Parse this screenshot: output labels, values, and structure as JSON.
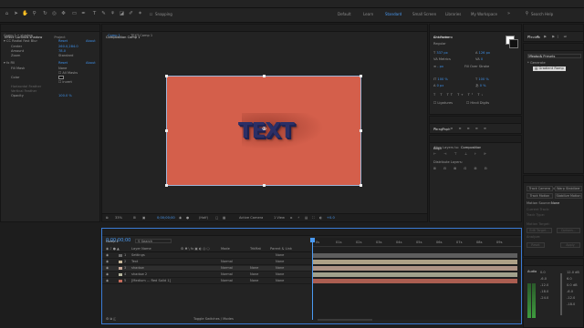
{
  "menu": [
    "File",
    "Edit",
    "Composition",
    "Layer",
    "Effect",
    "Animation",
    "View",
    "Window",
    "Help"
  ],
  "toolbar": {
    "snapping_label": "Snapping",
    "workspaces": [
      "Default",
      "Learn",
      "Standard",
      "Small Screen",
      "Libraries",
      "My Workspace"
    ],
    "active_workspace": "Standard",
    "search_placeholder": "Search Help"
  },
  "effect_controls": {
    "tabs": [
      "Effect Controls shadow",
      "Project"
    ],
    "layer_path": "Comp 1 • shadow",
    "effect1": {
      "name": "CC Radial Fast Blur",
      "reset": "Reset",
      "about": "About"
    },
    "center": {
      "label": "Center",
      "value": "260.0,284.0"
    },
    "amount": {
      "label": "Amount",
      "value": "78.0"
    },
    "zoom": {
      "label": "Zoom",
      "value": "Standard"
    },
    "effect2": {
      "name": "Fill",
      "reset": "Reset",
      "about": "About"
    },
    "fill_mask": {
      "label": "Fill Mask",
      "value": "None"
    },
    "all_masks": "All Masks",
    "color": {
      "label": "Color"
    },
    "invert": "Invert",
    "h_feather": "Horizontal Feather",
    "v_feather": "Vertical Feather",
    "opacity": {
      "label": "Opacity",
      "value": "100.0 %"
    }
  },
  "composition": {
    "tab": "Composition Comp 1",
    "breadcrumbs": [
      "Comp 1",
      "TEXT Comp 1"
    ],
    "text": "TEXT",
    "bg_color": "#d45f4b",
    "zoom": "33%",
    "timecode": "0;00;00;00",
    "resolution": "(Half)",
    "camera": "Active Camera",
    "views": "1 View",
    "exposure": "+0.0"
  },
  "timeline": {
    "tab": "Comp 1",
    "timecode": "0;00;00;00",
    "search_placeholder": "Search",
    "columns": {
      "name": "Layer Name",
      "mode": "Mode",
      "trkmat": "TrkMat",
      "parent": "Parent & Link"
    },
    "layers": [
      {
        "num": "1",
        "name": "Settings",
        "mode": "",
        "trk": "",
        "parent": "None",
        "color": "#6a6a6a"
      },
      {
        "num": "2",
        "name": "Text",
        "mode": "Normal",
        "trk": "",
        "parent": "None",
        "color": "#c8b89a"
      },
      {
        "num": "3",
        "name": "shadow",
        "mode": "Normal",
        "trk": "None",
        "parent": "None",
        "color": "#c8a898"
      },
      {
        "num": "4",
        "name": "shadow 2",
        "mode": "Normal",
        "trk": "None",
        "parent": "None",
        "color": "#b8b8a0"
      },
      {
        "num": "5",
        "name": "[Medium ... Red Solid 1]",
        "mode": "Normal",
        "trk": "None",
        "parent": "None",
        "color": "#c46a5a"
      }
    ],
    "ruler": [
      "0s",
      "01s",
      "02s",
      "03s",
      "04s",
      "05s",
      "06s",
      "07s",
      "08s",
      "09s"
    ],
    "toggle_label": "Toggle Switches / Modes"
  },
  "info_panel": {
    "tabs": [
      "Info",
      "Audio"
    ]
  },
  "character": {
    "tab": "Character",
    "font": "Ant Romero",
    "style": "Regular",
    "size": "337 px",
    "leading": "126 px",
    "kerning": "Metrics",
    "tracking": "0",
    "stroke": "- px",
    "stroke_type": "Fill Over Stroke",
    "vscale": "100 %",
    "hscale": "100 %",
    "baseline": "0 px",
    "tsume": "0 %",
    "ligatures": "Ligatures",
    "hindi": "Hindi Digits"
  },
  "paragraph": {
    "tab": "Paragraph"
  },
  "align": {
    "tab": "Align",
    "align_to_label": "Align Layers to:",
    "align_to_value": "Composition",
    "distribute": "Distribute Layers:"
  },
  "preview": {
    "tab": "Preview"
  },
  "effects_presets": {
    "tab": "Effects & Presets",
    "search": "ramp",
    "category": "* Generate",
    "item": "Gradient Ramp"
  },
  "tracker": {
    "tabs": [
      "Tracker",
      "Info"
    ],
    "buttons": [
      "Track Camera",
      "Warp Stabilizer",
      "Track Motion",
      "Stabilize Motion"
    ],
    "motion_source_label": "Motion Source:",
    "motion_source_value": "None",
    "current_track": "Current Track:",
    "track_type": "Track Type:",
    "motion_target": "Motion Target:",
    "edit_target": "Edit Target...",
    "options": "Options...",
    "analyze": "Analyze:",
    "reset": "Reset",
    "apply": "Apply"
  },
  "audio": {
    "tab": "Audio",
    "left_scale": [
      "0.0",
      "-6.0",
      "-12.0",
      "-18.0",
      "-24.0"
    ],
    "right_scale": [
      "12.0 dB",
      "6.0",
      "0.0 dB",
      "-6.0",
      "-12.0",
      "-18.0"
    ]
  }
}
